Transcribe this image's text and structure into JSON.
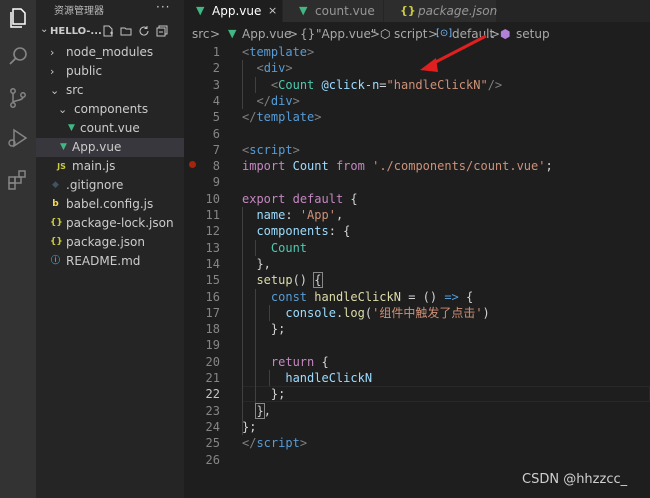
{
  "activity_bar": {
    "icons": [
      "explorer-icon",
      "search-icon",
      "source-control-icon",
      "run-debug-icon",
      "extensions-icon"
    ]
  },
  "sidebar": {
    "title": "资源管理器",
    "more": "···",
    "project": "HELLO-...",
    "tree": [
      {
        "label": "node_modules",
        "kind": "folder",
        "expanded": false
      },
      {
        "label": "public",
        "kind": "folder",
        "expanded": false
      },
      {
        "label": "src",
        "kind": "folder",
        "expanded": true
      },
      {
        "label": "components",
        "kind": "folder",
        "expanded": true
      },
      {
        "label": "count.vue",
        "kind": "vue"
      },
      {
        "label": "App.vue",
        "kind": "vue",
        "active": true
      },
      {
        "label": "main.js",
        "kind": "js",
        "icon_text": "JS"
      },
      {
        "label": ".gitignore",
        "kind": "git"
      },
      {
        "label": "babel.config.js",
        "kind": "babel"
      },
      {
        "label": "package-lock.json",
        "kind": "json",
        "icon_text": "{}"
      },
      {
        "label": "package.json",
        "kind": "json",
        "icon_text": "{}"
      },
      {
        "label": "README.md",
        "kind": "info"
      }
    ]
  },
  "tabs": [
    {
      "label": "App.vue",
      "active": true,
      "close": "×"
    },
    {
      "label": "count.vue",
      "active": false
    },
    {
      "label": "package.json",
      "active": false,
      "icon_text": "{}"
    }
  ],
  "breadcrumb": {
    "src": "src",
    "sep": ">",
    "file": "App.vue",
    "obj_icon": "{}",
    "obj": "\"App.vue\"",
    "script": "script",
    "default": "default",
    "setup": "setup"
  },
  "editor": {
    "line_numbers": [
      "1",
      "2",
      "3",
      "4",
      "5",
      "6",
      "7",
      "8",
      "9",
      "10",
      "11",
      "12",
      "13",
      "14",
      "15",
      "16",
      "17",
      "18",
      "19",
      "20",
      "21",
      "22",
      "23",
      "24",
      "25",
      "26"
    ],
    "current_line": 22,
    "breakpoint_line": 8
  },
  "watermark": "CSDN @hhzzcc_",
  "colors": {
    "vue_green": "#41b883",
    "js_yellow": "#cbcb41",
    "json_yellow": "#cbcb41",
    "arrow_red": "#e02020",
    "breakpoint": "#a1260d"
  }
}
